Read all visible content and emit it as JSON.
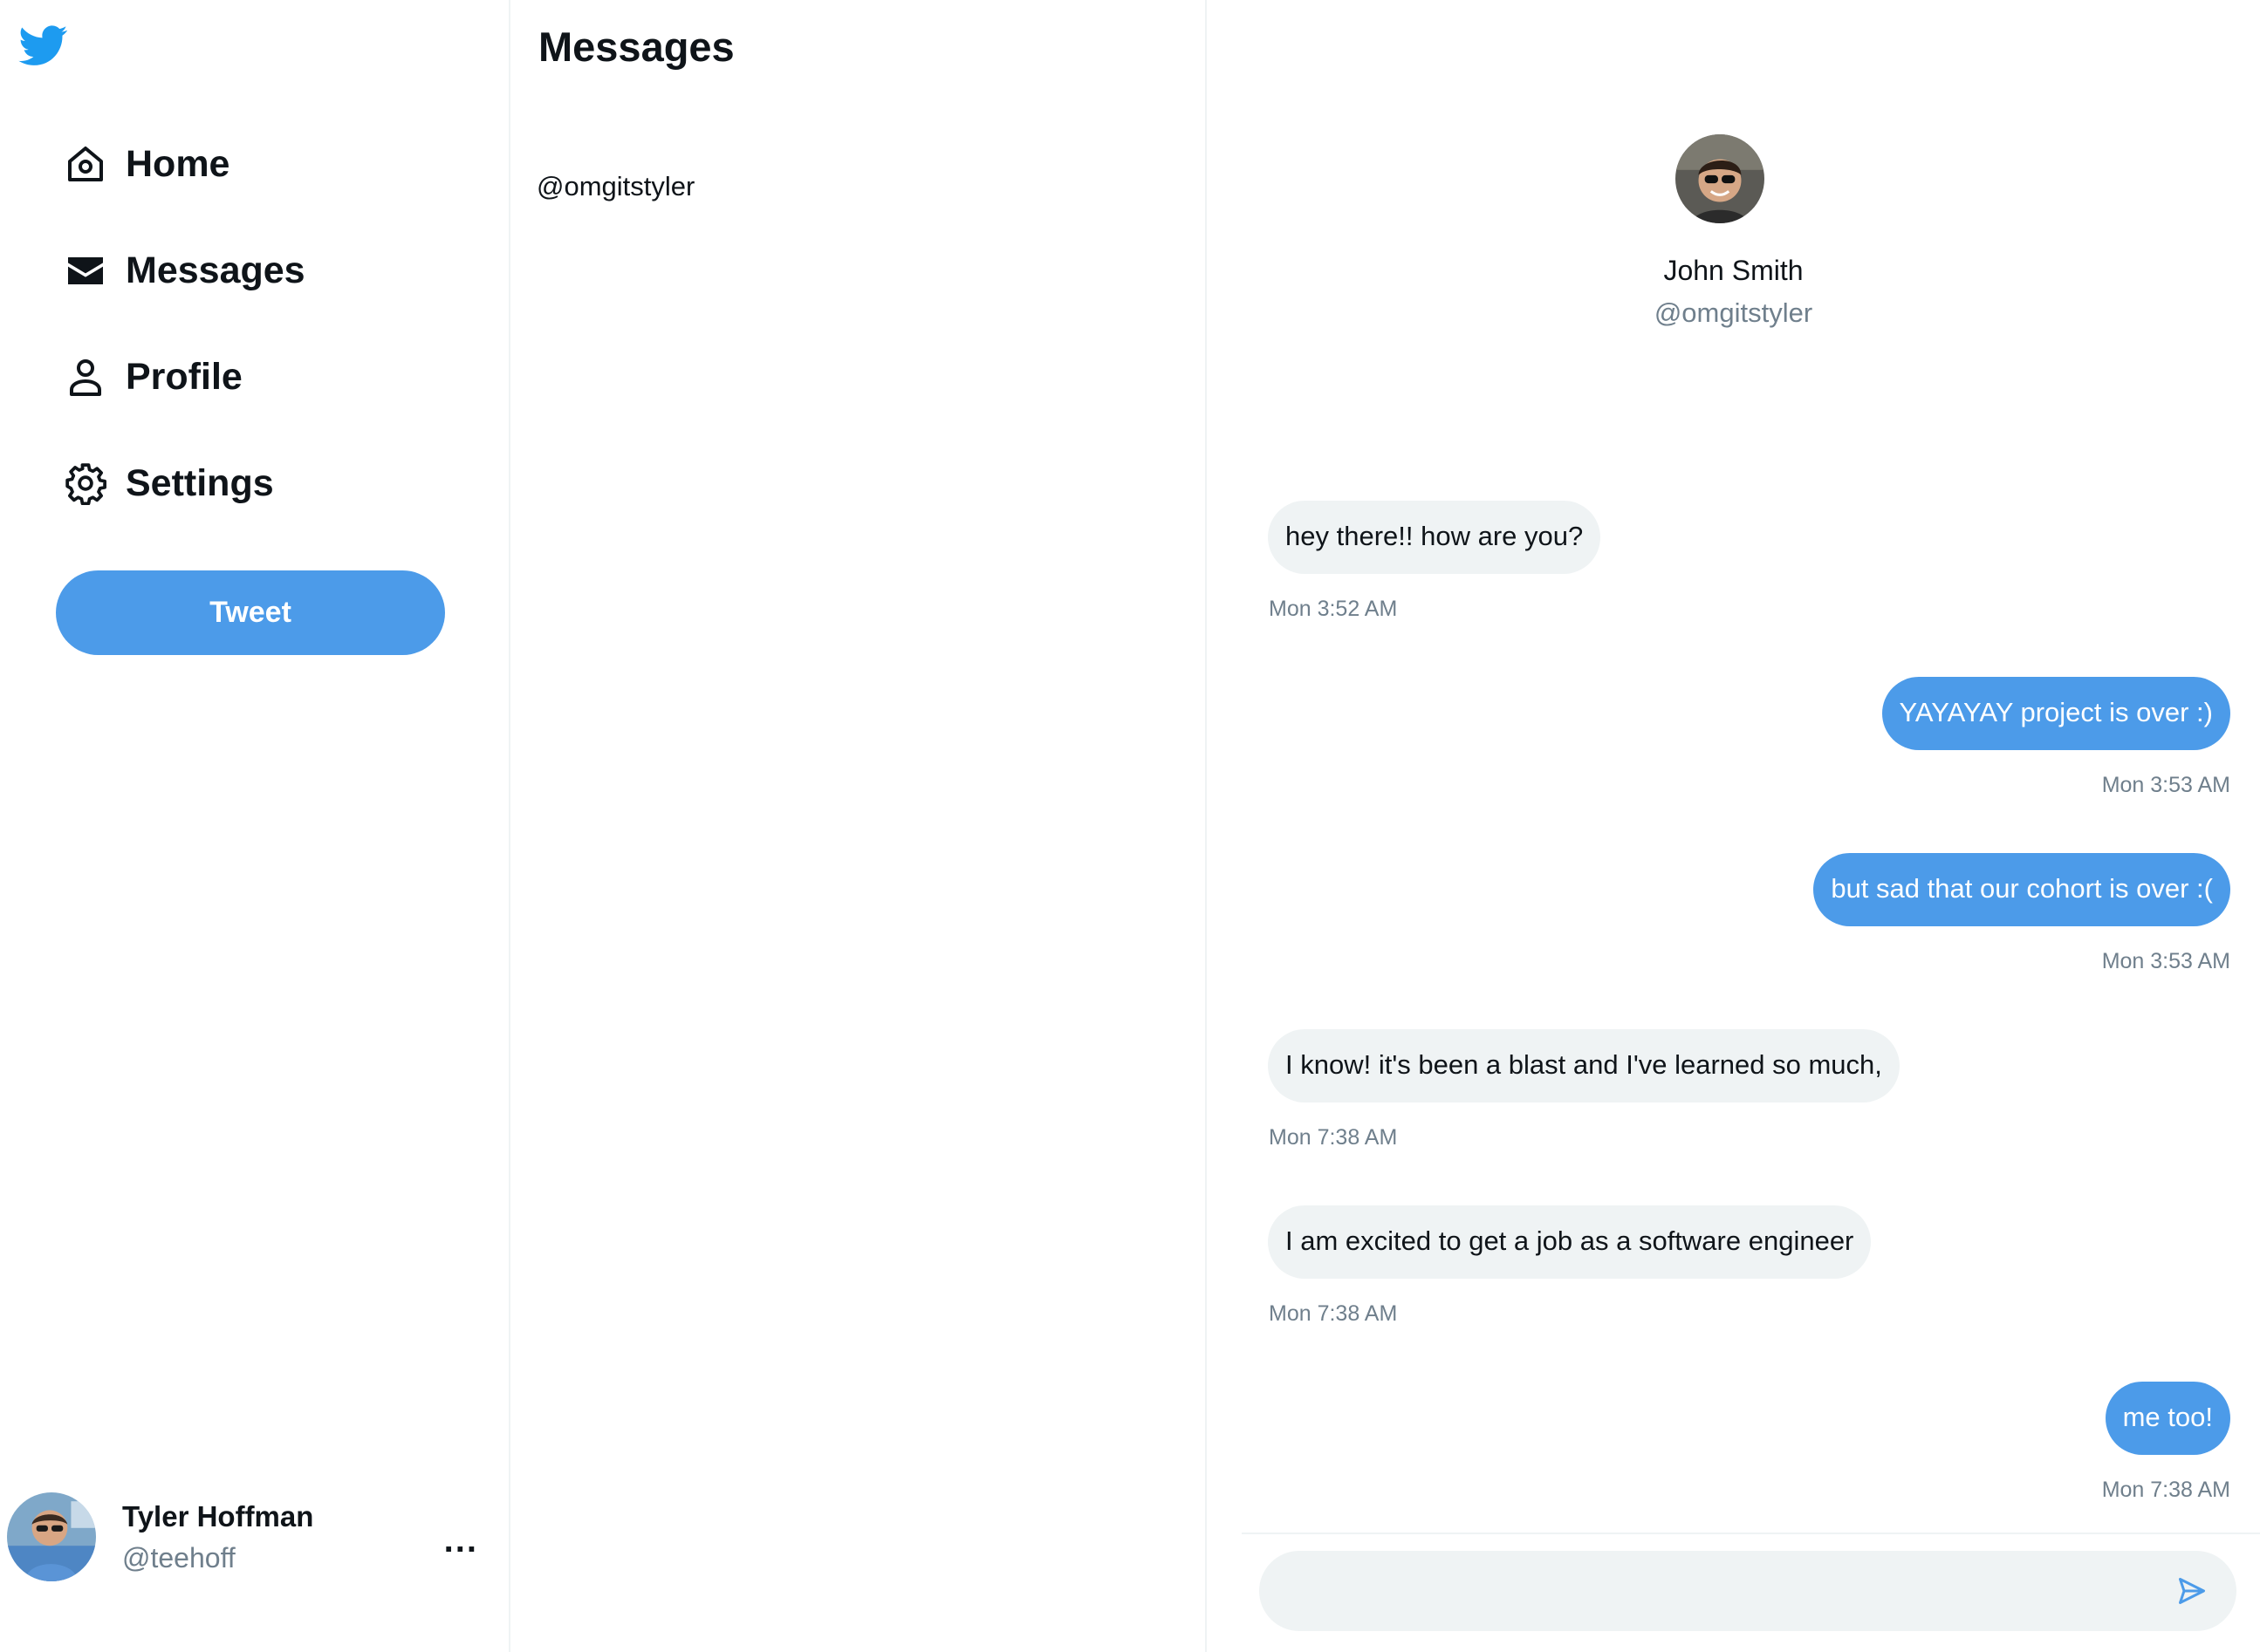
{
  "brand": {
    "name": "Twitter",
    "icon": "twitter-bird-icon",
    "color": "#1d9bf0"
  },
  "nav": {
    "items": [
      {
        "label": "Home",
        "icon": "home-icon"
      },
      {
        "label": "Messages",
        "icon": "envelope-icon"
      },
      {
        "label": "Profile",
        "icon": "person-icon"
      },
      {
        "label": "Settings",
        "icon": "gear-icon"
      }
    ],
    "tweet_label": "Tweet"
  },
  "account": {
    "display_name": "Tyler Hoffman",
    "handle": "@teehoff",
    "more_label": "..."
  },
  "conversations": {
    "title": "Messages",
    "items": [
      {
        "handle": "@omgitstyler"
      }
    ]
  },
  "chat": {
    "contact": {
      "name": "John Smith",
      "handle": "@omgitstyler"
    },
    "messages": [
      {
        "text": "hey there!! how are you?",
        "time": "Mon 3:52 AM",
        "direction": "incoming"
      },
      {
        "text": "YAYAYAY project is over :)",
        "time": "Mon 3:53 AM",
        "direction": "outgoing"
      },
      {
        "text": "but sad that our cohort is over :(",
        "time": "Mon 3:53 AM",
        "direction": "outgoing"
      },
      {
        "text": "I know! it's been a blast and I've learned so much,",
        "time": "Mon 7:38 AM",
        "direction": "incoming"
      },
      {
        "text": "I am excited to get a job as a software engineer",
        "time": "Mon 7:38 AM",
        "direction": "incoming"
      },
      {
        "text": "me too!",
        "time": "Mon 7:38 AM",
        "direction": "outgoing"
      }
    ],
    "compose": {
      "value": "",
      "placeholder": "",
      "send_icon": "send-icon"
    }
  },
  "colors": {
    "accent": "#4c9be9",
    "bubble_incoming": "#eff3f4",
    "muted_text": "#6f7f8c"
  }
}
